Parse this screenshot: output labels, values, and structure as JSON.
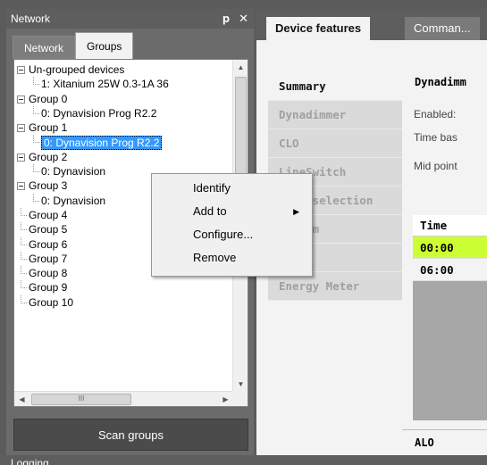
{
  "left_panel": {
    "title": "Network",
    "pin_icon": "pin-icon",
    "close_icon": "close-icon",
    "tabs": [
      "Network",
      "Groups"
    ],
    "active_tab": "Groups",
    "tree": [
      {
        "label": "Un-grouped devices",
        "level": 0
      },
      {
        "label": "1: Xitanium 25W 0.3-1A 36",
        "level": 1
      },
      {
        "label": "Group 0",
        "level": 0
      },
      {
        "label": "0: Dynavision Prog R2.2",
        "level": 1
      },
      {
        "label": "Group 1",
        "level": 0
      },
      {
        "label": "0: Dynavision Prog R2.2",
        "level": 1,
        "selected": true
      },
      {
        "label": "Group 2",
        "level": 0
      },
      {
        "label": "0: Dynavision",
        "level": 1
      },
      {
        "label": "Group 3",
        "level": 0
      },
      {
        "label": "0: Dynavision",
        "level": 1
      },
      {
        "label": "Group 4",
        "level": 0
      },
      {
        "label": "Group 5",
        "level": 0
      },
      {
        "label": "Group 6",
        "level": 0
      },
      {
        "label": "Group 7",
        "level": 0
      },
      {
        "label": "Group 8",
        "level": 0
      },
      {
        "label": "Group 9",
        "level": 0
      },
      {
        "label": "Group 10",
        "level": 0
      }
    ],
    "hscroll_thumb": "III",
    "scan_button": "Scan groups"
  },
  "context_menu": {
    "items": [
      {
        "label": "Identify",
        "submenu": false
      },
      {
        "label": "Add to",
        "submenu": true
      },
      {
        "label": "Configure...",
        "submenu": false
      },
      {
        "label": "Remove",
        "submenu": false
      }
    ]
  },
  "right_panel": {
    "tabs": [
      "Device features",
      "Comman..."
    ],
    "active_tab": "Device features",
    "features": [
      "Summary",
      "Dynadimmer",
      "CLO",
      "LineSwitch",
      "Lamp selection",
      "AmpDim",
      "",
      "Energy Meter"
    ],
    "active_feature": "Summary",
    "content": {
      "heading": "Dynadimm",
      "props": [
        "Enabled:",
        "Time bas",
        "Mid point"
      ],
      "table_header": "Time",
      "rows": [
        "00:00",
        "06:00"
      ],
      "highlight_color": "#ccff33",
      "footer": "ALO"
    }
  },
  "bottom_panel": {
    "title": "Logging"
  },
  "colors": {
    "background": "#5b5b5b",
    "selection": "#3399ff",
    "highlight": "#ccff33"
  }
}
